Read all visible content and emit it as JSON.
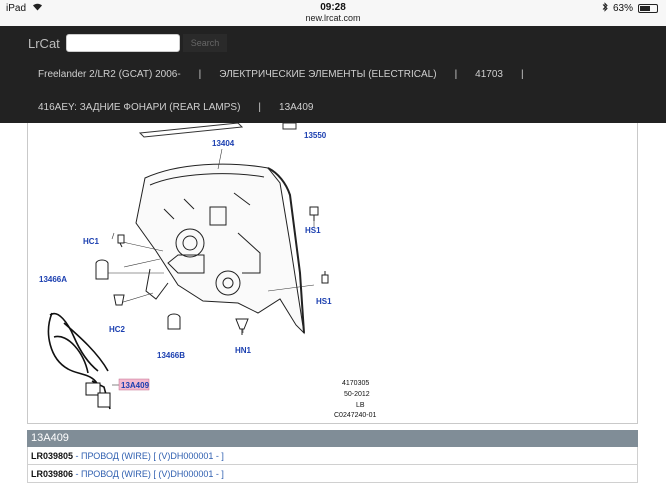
{
  "statusbar": {
    "device": "iPad",
    "time": "09:28",
    "url": "new.lrcat.com",
    "battery": "63%",
    "battery_level": 0.63
  },
  "navbar": {
    "brand": "LrCat",
    "search_placeholder": "",
    "search_button": "Search",
    "breadcrumbs": [
      "Freelander 2/LR2 (GCAT) 2006-",
      "ЭЛЕКТРИЧЕСКИЕ ЭЛЕМЕНТЫ (ELECTRICAL)",
      "41703",
      "416AEY: ЗАДНИЕ ФОНАРИ (REAR LAMPS)",
      "13A409"
    ]
  },
  "diagram": {
    "callouts": {
      "c13404": "13404",
      "c13550": "13550",
      "hc1": "HC1",
      "hs1a": "HS1",
      "c13466a": "13466A",
      "hs1b": "HS1",
      "hc2": "HC2",
      "c13466b": "13466B",
      "hn1": "HN1",
      "c13a409": "13A409"
    },
    "reference": [
      "4170305",
      "50-2012",
      "LB",
      "C0247240-01"
    ]
  },
  "parts": {
    "header": "13A409",
    "rows": [
      {
        "number": "LR039805",
        "description": " - ПРОВОД (WIRE) [ (V)DH000001 - ]"
      },
      {
        "number": "LR039806",
        "description": " - ПРОВОД (WIRE) [ (V)DH000001 - ]"
      }
    ]
  }
}
